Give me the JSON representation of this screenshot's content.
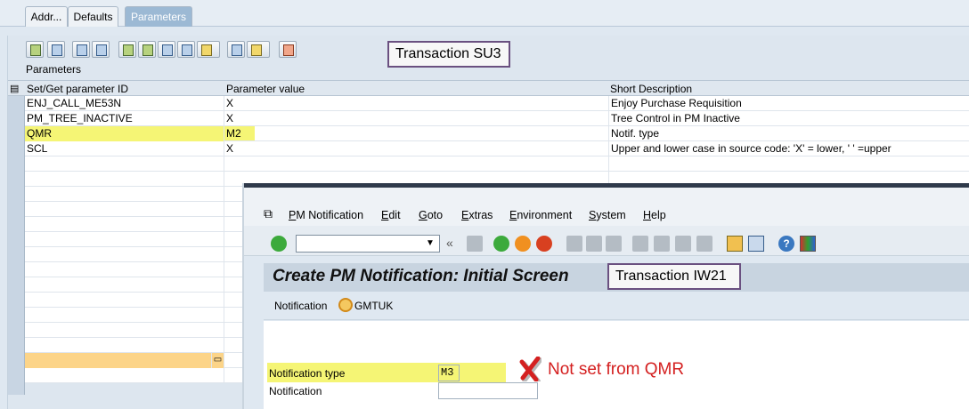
{
  "tabs": [
    "Addr...",
    "Defaults",
    "Parameters"
  ],
  "parameters_panel": {
    "group_title": "Parameters",
    "columns": [
      "Set/Get parameter ID",
      "Parameter value",
      "Short Description"
    ],
    "rows": [
      {
        "id": "ENJ_CALL_ME53N",
        "value": "X",
        "desc": "Enjoy Purchase Requisition"
      },
      {
        "id": "PM_TREE_INACTIVE",
        "value": "X",
        "desc": "Tree Control in  PM Inactive"
      },
      {
        "id": "QMR",
        "value": "M2",
        "desc": "Notif. type"
      },
      {
        "id": "SCL",
        "value": "X",
        "desc": "Upper and lower case in source code: 'X' = lower, ' ' =upper"
      }
    ]
  },
  "callouts": {
    "su3": "Transaction SU3",
    "iw21": "Transaction IW21",
    "note": "Not set from QMR"
  },
  "iw21": {
    "menu": [
      "PM Notification",
      "Edit",
      "Goto",
      "Extras",
      "Environment",
      "System",
      "Help"
    ],
    "title": "Create PM Notification: Initial Screen",
    "notification_label": "Notification",
    "notification_value": "GMTUK",
    "fields": {
      "type_label": "Notification type",
      "type_value": "M3",
      "notif_label": "Notification",
      "notif_value": ""
    }
  },
  "colors": {
    "highlight": "#f5f575",
    "callout_border": "#6a5080",
    "note_red": "#d42020"
  }
}
